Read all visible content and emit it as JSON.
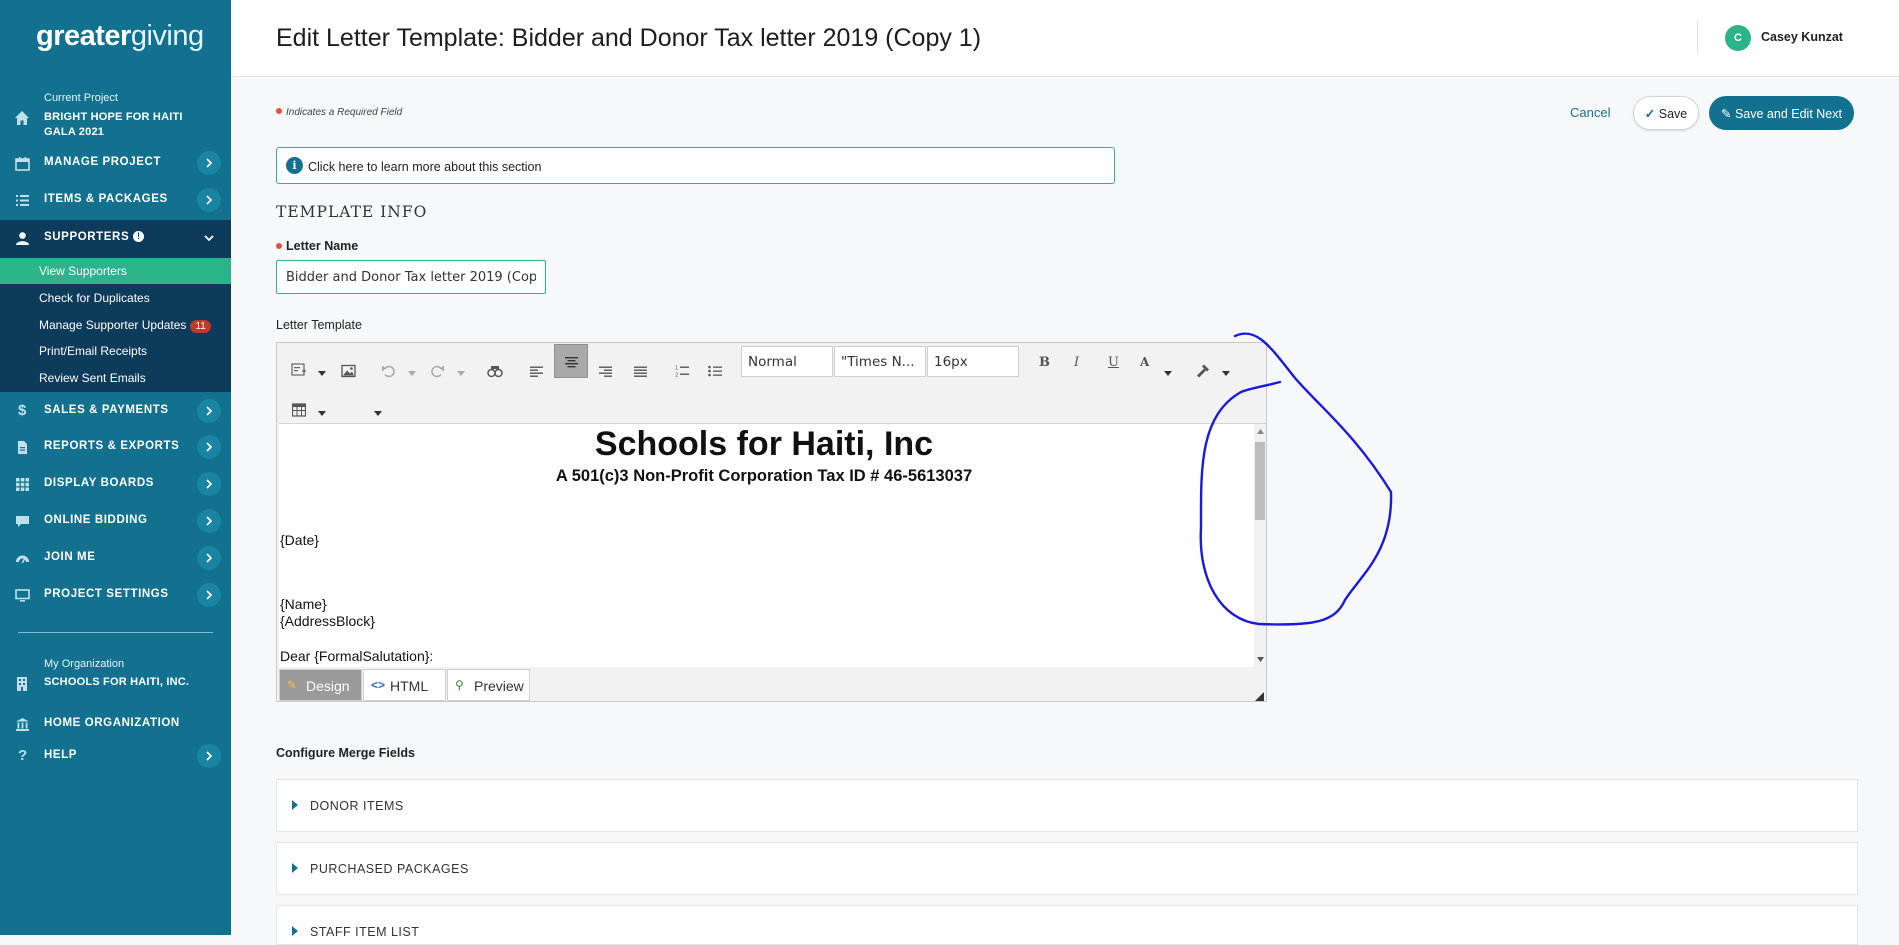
{
  "app": {
    "logo_bold": "greater",
    "logo_light": "giving"
  },
  "sidebar": {
    "project_caption": "Current Project",
    "project_name": "BRIGHT HOPE FOR HAITI GALA 2021",
    "nav": [
      {
        "label": "MANAGE PROJECT",
        "icon": "calendar-icon"
      },
      {
        "label": "ITEMS & PACKAGES",
        "icon": "list-icon"
      },
      {
        "label": "SUPPORTERS",
        "icon": "person-icon"
      },
      {
        "label": "SALES & PAYMENTS",
        "icon": "dollar-icon"
      },
      {
        "label": "REPORTS & EXPORTS",
        "icon": "document-icon"
      },
      {
        "label": "DISPLAY BOARDS",
        "icon": "grid-icon"
      },
      {
        "label": "ONLINE BIDDING",
        "icon": "chat-icon"
      },
      {
        "label": "JOIN ME",
        "icon": "gauge-icon"
      },
      {
        "label": "PROJECT SETTINGS",
        "icon": "monitor-icon"
      }
    ],
    "subnav": [
      {
        "label": "View Supporters"
      },
      {
        "label": "Check for Duplicates"
      },
      {
        "label": "Manage Supporter Updates",
        "badge": "11"
      },
      {
        "label": "Print/Email Receipts"
      },
      {
        "label": "Review Sent Emails"
      }
    ],
    "org_caption": "My Organization",
    "org_name": "SCHOOLS FOR HAITI, INC.",
    "home_org": "HOME ORGANIZATION",
    "help": "HELP"
  },
  "header": {
    "title": "Edit Letter Template: Bidder and Donor Tax letter 2019 (Copy 1)",
    "user_initial": "C",
    "user_name": "Casey Kunzat"
  },
  "form": {
    "required_note": "Indicates a Required Field",
    "cancel_label": "Cancel",
    "save_label": "Save",
    "save_edit_label": "Save and Edit Next",
    "info_text": "Click here to learn more about this section",
    "section_title": "TEMPLATE INFO",
    "letter_name_label": "Letter Name",
    "letter_name_value": "Bidder and Donor Tax letter 2019 (Copy 1)",
    "template_label": "Letter Template"
  },
  "editor": {
    "format_select": "Normal",
    "font_select": "\"Times N...",
    "size_select": "16px",
    "bold": "B",
    "italic": "I",
    "underline": "U",
    "font_color": "A",
    "doc_title": "Schools for Haiti, Inc",
    "doc_subtitle": "A 501(c)3 Non-Profit Corporation Tax ID # 46-5613037",
    "doc_lines": [
      "{Date}",
      "{Name}",
      "{AddressBlock}",
      "Dear {FormalSalutation}:"
    ],
    "mode_tabs": [
      "Design",
      "HTML",
      "Preview"
    ]
  },
  "merge": {
    "title": "Configure Merge Fields",
    "sections": [
      "DONOR ITEMS",
      "PURCHASED PACKAGES",
      "STAFF ITEM LIST"
    ]
  },
  "colors": {
    "sidebar": "#11718f",
    "sidebar_active": "#0d3b5c",
    "accent_green": "#2bb38a",
    "annotation": "#1a1adb"
  }
}
